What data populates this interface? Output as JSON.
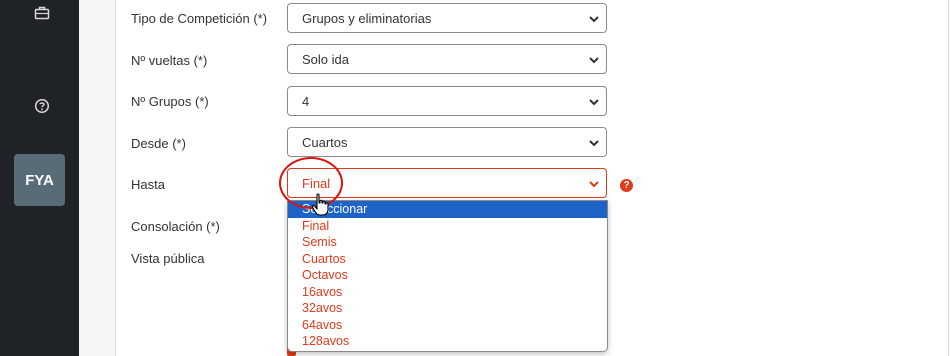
{
  "sidebar": {
    "icons": [
      "briefcase-icon",
      "help-circle-icon"
    ],
    "avatar_text": "FYA"
  },
  "form": {
    "tipo_label": "Tipo de Competición (*)",
    "tipo_value": "Grupos y eliminatorias",
    "vueltas_label": "Nº vueltas (*)",
    "vueltas_value": "Solo ida",
    "grupos_label": "Nº Grupos (*)",
    "grupos_value": "4",
    "desde_label": "Desde (*)",
    "desde_value": "Cuartos",
    "hasta_label": "Hasta",
    "hasta_value": "Final",
    "consolacion_label": "Consolación (*)",
    "vista_label": "Vista pública",
    "help_symbol": "?"
  },
  "dropdown": {
    "options": [
      "Seleccionar",
      "Final",
      "Semis",
      "Cuartos",
      "Octavos",
      "16avos",
      "32avos",
      "64avos",
      "128avos"
    ],
    "highlighted_index": 0
  },
  "colors": {
    "error": "#e03a1a",
    "highlight": "#1e64c8",
    "sidebar": "#1f2327"
  }
}
